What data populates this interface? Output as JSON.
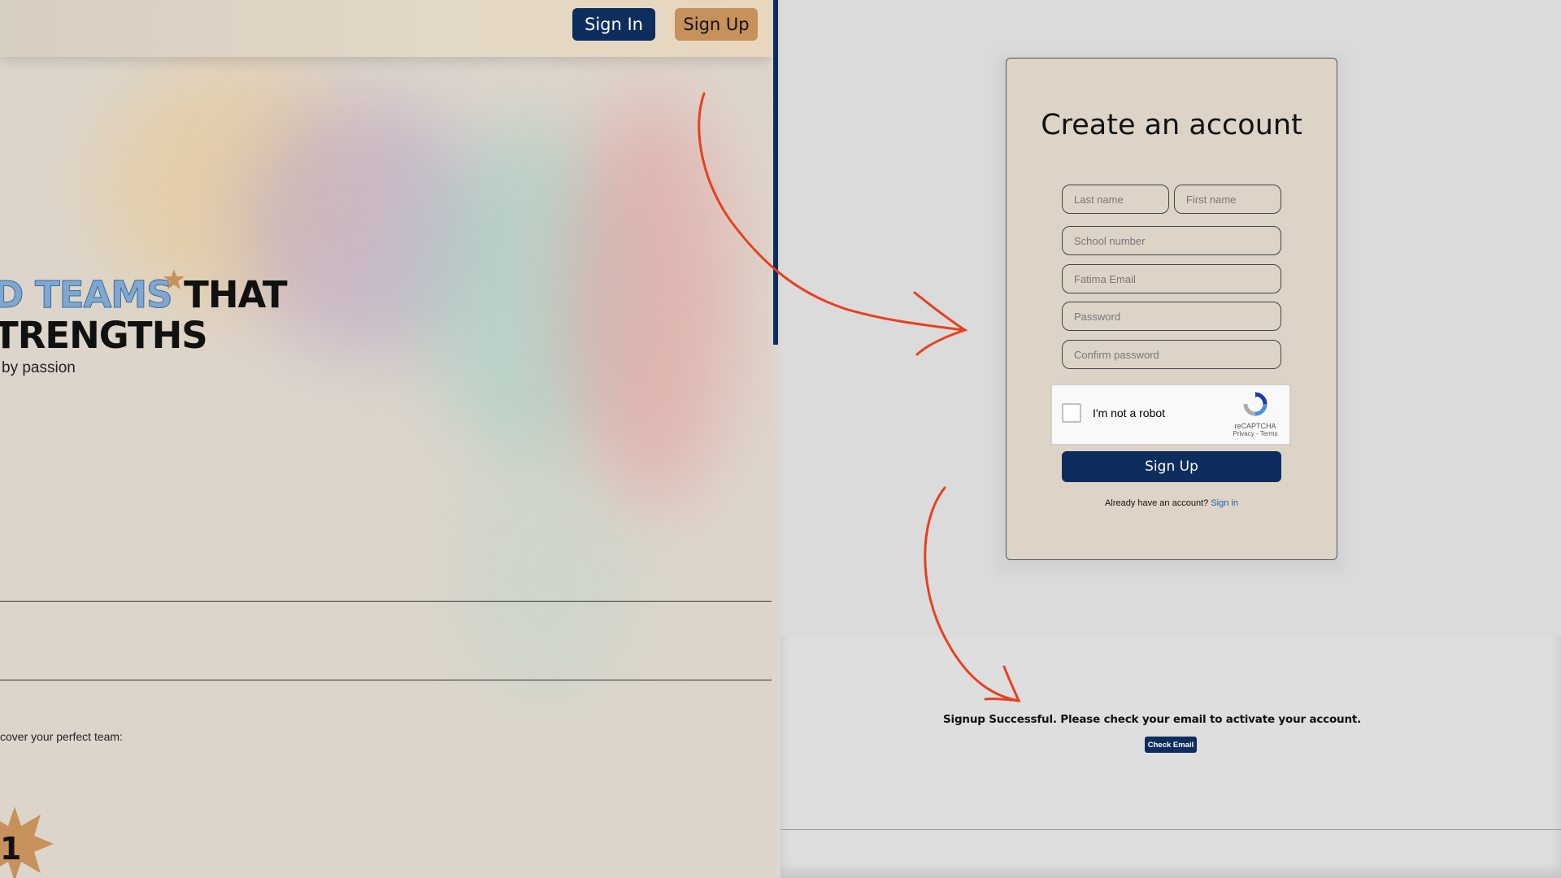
{
  "left_page": {
    "nav": {
      "sign_in": "Sign In",
      "sign_up": "Sign Up"
    },
    "hero": {
      "accent_text": "D TEAMS",
      "line1_rest": " THAT",
      "line2": "TRENGTHS",
      "subtitle": "by passion"
    },
    "discover_text": "cover your perfect team:",
    "step_number": "1"
  },
  "signup_form": {
    "title": "Create an account",
    "fields": {
      "last_name": "Last name",
      "first_name": "First name",
      "school_number": "School number",
      "email": "Fatima Email",
      "password": "Password",
      "confirm_password": "Confirm password"
    },
    "captcha": {
      "label": "I'm not a robot",
      "brand": "reCAPTCHA",
      "links": "Privacy - Terms"
    },
    "submit_label": "Sign Up",
    "already_text": "Already have an account?",
    "sign_in_link": "Sign in"
  },
  "confirmation": {
    "message": "Signup Successful. Please check your email to activate your account.",
    "button_label": "Check Email"
  },
  "colors": {
    "navy": "#0c2d5e",
    "tan": "#c6915a",
    "arrow_red": "#e8401e",
    "card_bg": "#ddd4c7"
  }
}
